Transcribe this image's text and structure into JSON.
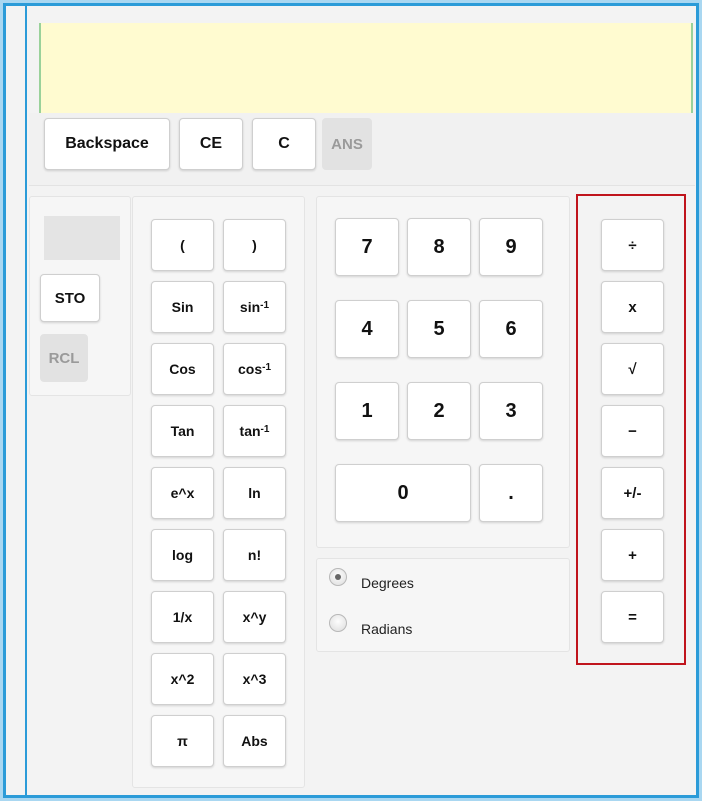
{
  "display": {
    "value": ""
  },
  "top_bar": {
    "backspace": "Backspace",
    "ce": "CE",
    "c": "C",
    "ans": "ANS"
  },
  "memory": {
    "sto": "STO",
    "rcl": "RCL"
  },
  "scientific": {
    "open_paren": "(",
    "close_paren": ")",
    "sin": "Sin",
    "asin_base": "sin",
    "asin_sup": "-1",
    "cos": "Cos",
    "acos_base": "cos",
    "acos_sup": "-1",
    "tan": "Tan",
    "atan_base": "tan",
    "atan_sup": "-1",
    "exp": "e^x",
    "ln": "ln",
    "log": "log",
    "fact": "n!",
    "recip": "1/x",
    "pow": "x^y",
    "square": "x^2",
    "cube": "x^3",
    "pi": "π",
    "abs": "Abs"
  },
  "numpad": {
    "n7": "7",
    "n8": "8",
    "n9": "9",
    "n4": "4",
    "n5": "5",
    "n6": "6",
    "n1": "1",
    "n2": "2",
    "n3": "3",
    "n0": "0",
    "dot": "."
  },
  "angle_mode": {
    "degrees": "Degrees",
    "radians": "Radians",
    "selected": "Degrees"
  },
  "operators": {
    "divide": "÷",
    "multiply": "x",
    "sqrt": "√",
    "subtract": "−",
    "negate": "+/-",
    "add": "+",
    "equals": "="
  },
  "colors": {
    "frame": "#2b9bd8",
    "display_bg": "#fffbd0",
    "highlight": "#c0141c"
  }
}
